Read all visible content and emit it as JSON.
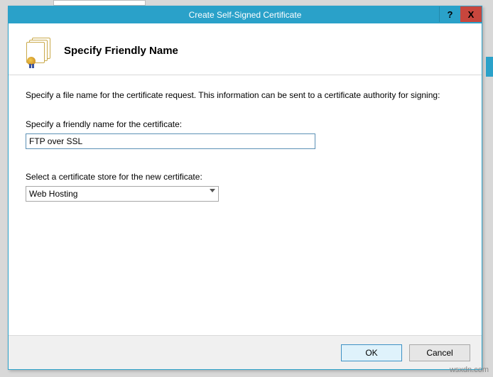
{
  "window": {
    "title": "Create Self-Signed Certificate",
    "help_glyph": "?",
    "close_glyph": "X"
  },
  "header": {
    "title": "Specify Friendly Name"
  },
  "content": {
    "intro": "Specify a file name for the certificate request.  This information can be sent to a certificate authority for signing:",
    "friendly_label": "Specify a friendly name for the certificate:",
    "friendly_value": "FTP over SSL",
    "store_label": "Select a certificate store for the new certificate:",
    "store_value": "Web Hosting"
  },
  "buttons": {
    "ok": "OK",
    "cancel": "Cancel"
  },
  "watermark": "wsxdn.com"
}
